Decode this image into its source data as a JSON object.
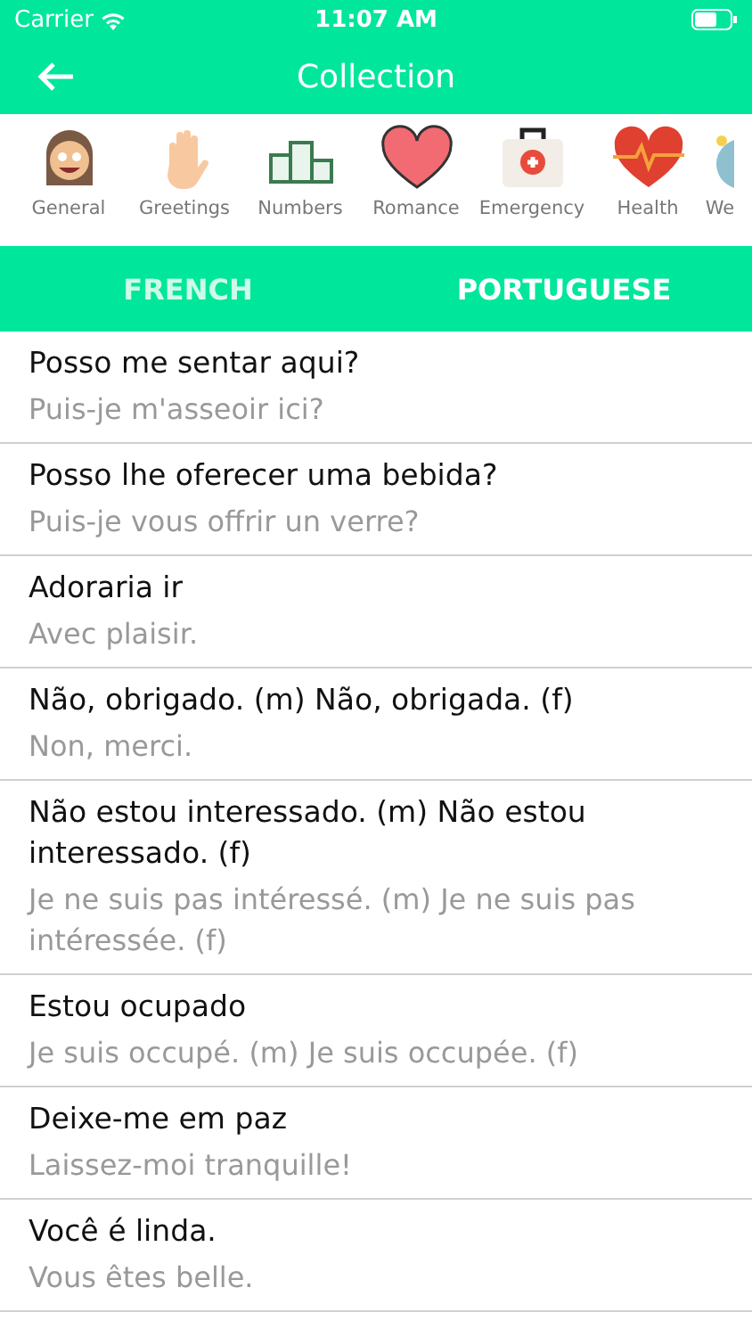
{
  "status_bar": {
    "carrier": "Carrier",
    "time": "11:07 AM"
  },
  "nav": {
    "title": "Collection"
  },
  "categories": [
    {
      "label": "General",
      "selected": false
    },
    {
      "label": "Greetings",
      "selected": false
    },
    {
      "label": "Numbers",
      "selected": false
    },
    {
      "label": "Romance",
      "selected": false
    },
    {
      "label": "Emergency",
      "selected": false
    },
    {
      "label": "Health",
      "selected": false
    },
    {
      "label": "We",
      "selected": false
    }
  ],
  "tabs": [
    {
      "label": "FRENCH",
      "selected": false
    },
    {
      "label": "PORTUGUESE",
      "selected": true
    }
  ],
  "phrases": [
    {
      "text": "Posso me sentar aqui?",
      "translation": "Puis-je m'asseoir ici?"
    },
    {
      "text": "Posso lhe oferecer uma bebida?",
      "translation": "Puis-je vous offrir un verre?"
    },
    {
      "text": "Adoraria ir",
      "translation": "Avec plaisir."
    },
    {
      "text": "Não, obrigado. (m)  Não, obrigada. (f)",
      "translation": "Non, merci."
    },
    {
      "text": "Não estou interessado. (m)  Não estou interessado. (f)",
      "translation": "Je ne suis pas intéressé. (m)  Je ne suis pas intéressée. (f)"
    },
    {
      "text": "Estou ocupado",
      "translation": "Je suis occupé. (m)  Je suis occupée. (f)"
    },
    {
      "text": "Deixe-me em paz",
      "translation": "Laissez-moi tranquille!"
    },
    {
      "text": "Você é linda.",
      "translation": "Vous êtes belle."
    }
  ]
}
